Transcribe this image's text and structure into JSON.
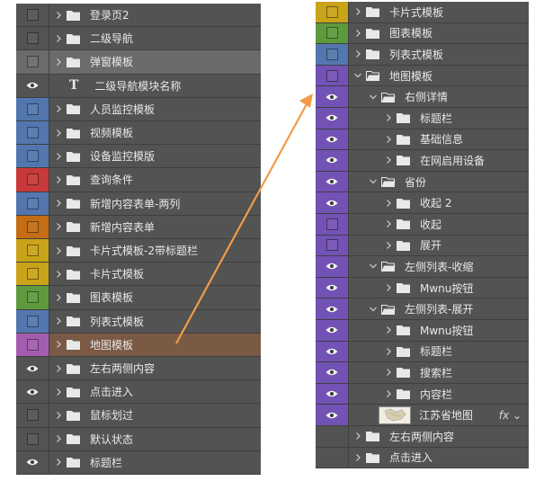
{
  "left_panel": {
    "layers": [
      {
        "name": "登录页2",
        "vis": "box",
        "color": "#535353",
        "type": "group"
      },
      {
        "name": "二级导航",
        "vis": "box",
        "color": "#535353",
        "type": "group"
      },
      {
        "name": "弹窗模板",
        "vis": "box",
        "color": "#535353",
        "type": "group",
        "selected": true
      },
      {
        "name": "二级导航模块名称",
        "vis": "eye",
        "color": "#535353",
        "type": "text"
      },
      {
        "name": "人员监控模板",
        "vis": "box",
        "color": "#5277ae",
        "type": "group"
      },
      {
        "name": "视频模板",
        "vis": "box",
        "color": "#5277ae",
        "type": "group"
      },
      {
        "name": "设备监控模版",
        "vis": "box",
        "color": "#5277ae",
        "type": "group"
      },
      {
        "name": "查询条件",
        "vis": "box",
        "color": "#c83a3a",
        "type": "group"
      },
      {
        "name": "新增内容表单-两列",
        "vis": "box",
        "color": "#5277ae",
        "type": "group"
      },
      {
        "name": "新增内容表单",
        "vis": "box",
        "color": "#c46d14",
        "type": "group"
      },
      {
        "name": "卡片式模板-2带标题栏",
        "vis": "box",
        "color": "#c9a318",
        "type": "group"
      },
      {
        "name": "卡片式模板",
        "vis": "box",
        "color": "#c9a318",
        "type": "group"
      },
      {
        "name": "图表模板",
        "vis": "box",
        "color": "#5e9a3d",
        "type": "group"
      },
      {
        "name": "列表式模板",
        "vis": "box",
        "color": "#5277ae",
        "type": "group"
      },
      {
        "name": "地图模板",
        "vis": "box",
        "color": "#a35db0",
        "type": "group",
        "highlight": true
      },
      {
        "name": "左右两侧内容",
        "vis": "eye",
        "color": "#535353",
        "type": "group"
      },
      {
        "name": "点击进入",
        "vis": "eye",
        "color": "#535353",
        "type": "group"
      },
      {
        "name": "鼠标划过",
        "vis": "box",
        "color": "#535353",
        "type": "group"
      },
      {
        "name": "默认状态",
        "vis": "box",
        "color": "#535353",
        "type": "group"
      },
      {
        "name": "标题栏",
        "vis": "eye",
        "color": "#535353",
        "type": "group"
      }
    ]
  },
  "right_panel": {
    "layers": [
      {
        "name": "卡片式模板",
        "vis": "box",
        "color": "#c9a318",
        "indent": 0,
        "open": false,
        "type": "group"
      },
      {
        "name": "图表模板",
        "vis": "box",
        "color": "#5e9a3d",
        "indent": 0,
        "open": false,
        "type": "group"
      },
      {
        "name": "列表式模板",
        "vis": "box",
        "color": "#5277ae",
        "indent": 0,
        "open": false,
        "type": "group"
      },
      {
        "name": "地图模板",
        "vis": "box",
        "color": "#7352b5",
        "indent": 0,
        "open": true,
        "type": "group"
      },
      {
        "name": "右侧详情",
        "vis": "eye",
        "color": "#7352b5",
        "indent": 1,
        "open": true,
        "type": "group"
      },
      {
        "name": "标题栏",
        "vis": "eye",
        "color": "#7352b5",
        "indent": 2,
        "open": false,
        "type": "group"
      },
      {
        "name": "基础信息",
        "vis": "eye",
        "color": "#7352b5",
        "indent": 2,
        "open": false,
        "type": "group"
      },
      {
        "name": "在网启用设备",
        "vis": "eye",
        "color": "#7352b5",
        "indent": 2,
        "open": false,
        "type": "group"
      },
      {
        "name": "省份",
        "vis": "eye",
        "color": "#7352b5",
        "indent": 1,
        "open": true,
        "type": "group"
      },
      {
        "name": "收起 2",
        "vis": "eye",
        "color": "#7352b5",
        "indent": 2,
        "open": false,
        "type": "group"
      },
      {
        "name": "收起",
        "vis": "box",
        "color": "#7352b5",
        "indent": 2,
        "open": false,
        "type": "group"
      },
      {
        "name": "展开",
        "vis": "box",
        "color": "#7352b5",
        "indent": 2,
        "open": false,
        "type": "group"
      },
      {
        "name": "左侧列表-收缩",
        "vis": "eye",
        "color": "#7352b5",
        "indent": 1,
        "open": true,
        "type": "group"
      },
      {
        "name": "Mwnu按钮",
        "vis": "eye",
        "color": "#7352b5",
        "indent": 2,
        "open": false,
        "type": "group"
      },
      {
        "name": "左侧列表-展开",
        "vis": "eye",
        "color": "#7352b5",
        "indent": 1,
        "open": true,
        "type": "group"
      },
      {
        "name": "Mwnu按钮",
        "vis": "eye",
        "color": "#7352b5",
        "indent": 2,
        "open": false,
        "type": "group"
      },
      {
        "name": "标题栏",
        "vis": "eye",
        "color": "#7352b5",
        "indent": 2,
        "open": false,
        "type": "group"
      },
      {
        "name": "搜索栏",
        "vis": "eye",
        "color": "#7352b5",
        "indent": 2,
        "open": false,
        "type": "group"
      },
      {
        "name": "内容栏",
        "vis": "eye",
        "color": "#7352b5",
        "indent": 2,
        "open": false,
        "type": "group"
      },
      {
        "name": "江苏省地图",
        "vis": "eye",
        "color": "#7352b5",
        "indent": 1,
        "open": false,
        "type": "image",
        "fx": "fx"
      },
      {
        "name": "左右两侧内容",
        "vis": "blank",
        "color": "#535353",
        "indent": 0,
        "open": false,
        "type": "group"
      },
      {
        "name": "点击进入",
        "vis": "blank",
        "color": "#535353",
        "indent": 0,
        "open": false,
        "type": "group"
      }
    ]
  },
  "colors": {
    "panel_bg": "#535353",
    "selected_bg": "#6b6b6b",
    "highlight_bg": "#7a5a45",
    "arrow": "#f39a4a"
  }
}
